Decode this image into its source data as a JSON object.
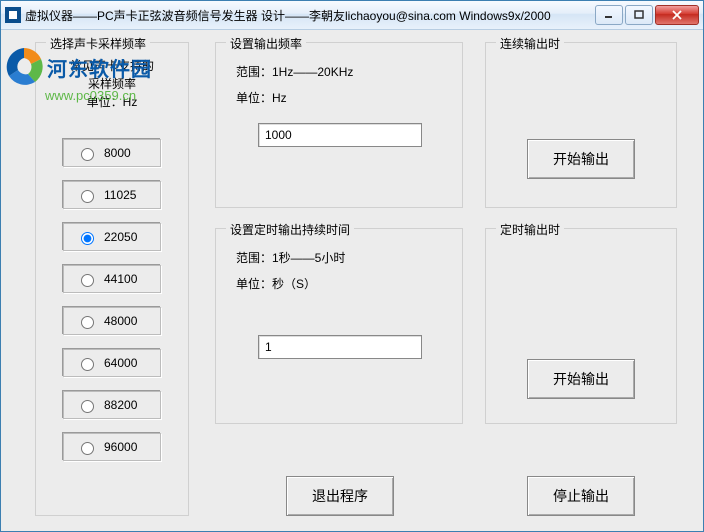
{
  "window": {
    "title": "虚拟仪器——PC声卡正弦波音频信号发生器     设计——李朝友lichaoyou@sina.com  Windows9x/2000"
  },
  "watermark": {
    "text": "河东软件园",
    "url": "www.pc0359.cn"
  },
  "sample": {
    "group_title": "选择声卡采样频率",
    "desc_line1": "常见声卡支持的",
    "desc_line2": "采样频率",
    "desc_line3": "单位：Hz",
    "options": [
      "8000",
      "11025",
      "22050",
      "44100",
      "48000",
      "64000",
      "88200",
      "96000"
    ],
    "selected": "22050"
  },
  "freq": {
    "group_title": "设置输出频率",
    "range": "范围：1Hz——20KHz",
    "unit": "单位：Hz",
    "value": "1000"
  },
  "duration": {
    "group_title": "设置定时输出持续时间",
    "range": "范围：1秒——5小时",
    "unit": "单位：秒（S）",
    "value": "1"
  },
  "continuous": {
    "group_title": "连续输出时",
    "start_label": "开始输出"
  },
  "timed": {
    "group_title": "定时输出时",
    "start_label": "开始输出"
  },
  "buttons": {
    "exit": "退出程序",
    "stop": "停止输出"
  }
}
